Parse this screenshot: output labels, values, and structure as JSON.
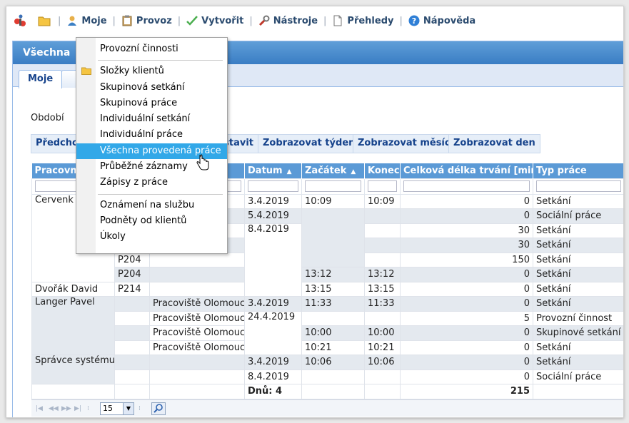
{
  "menubar": {
    "items": [
      {
        "label": "Moje",
        "icon": "user-icon"
      },
      {
        "label": "Provoz",
        "icon": "clipboard-icon"
      },
      {
        "label": "Vytvořit",
        "icon": "checkmark-icon"
      },
      {
        "label": "Nástroje",
        "icon": "wrench-icon"
      },
      {
        "label": "Přehledy",
        "icon": "document-icon"
      },
      {
        "label": "Nápověda",
        "icon": "help-icon"
      }
    ],
    "separator": "|"
  },
  "panel": {
    "title": "Všechna",
    "tabs": [
      "Moje"
    ],
    "period_label": "Období",
    "toolbar": [
      "Předcho",
      "stavit",
      "Zobrazovat týden",
      "Zobrazovat měsíc",
      "Zobrazovat den"
    ]
  },
  "dropdown": {
    "items": [
      "Provozní činnosti",
      "Složky klientů",
      "Skupinová setkání",
      "Skupinová práce",
      "Individuální setkání",
      "Individuální práce",
      "Všechna provedená práce",
      "Průběžné záznamy",
      "Zápisy z práce",
      "Oznámení na službu",
      "Podněty od klientů",
      "Úkoly"
    ],
    "active_index": 6
  },
  "grid": {
    "columns": [
      "Pracovn",
      "",
      "",
      "Datum",
      "Začátek",
      "Konec",
      "Celková délka trvání [min]",
      "Typ práce"
    ],
    "rows": [
      {
        "worker": "Červenk",
        "client": "",
        "place": "",
        "date": "3.4.2019",
        "start": "10:09",
        "end": "10:09",
        "duration": "0",
        "type": "Setkání"
      },
      {
        "worker": "",
        "client": "",
        "place": "",
        "date": "5.4.2019",
        "start": "",
        "end": "",
        "duration": "0",
        "type": "Sociální práce"
      },
      {
        "worker": "",
        "client": "",
        "place": "",
        "date": "8.4.2019",
        "start": "",
        "end": "",
        "duration": "30",
        "type": "Setkání"
      },
      {
        "worker": "",
        "client": "",
        "place": "",
        "date": "",
        "start": "",
        "end": "",
        "duration": "30",
        "type": "Setkání"
      },
      {
        "worker": "",
        "client": "P204",
        "place": "",
        "date": "",
        "start": "",
        "end": "",
        "duration": "150",
        "type": "Setkání"
      },
      {
        "worker": "",
        "client": "P204",
        "place": "",
        "date": "",
        "start": "13:12",
        "end": "13:12",
        "duration": "0",
        "type": "Setkání"
      },
      {
        "worker": "Dvořák David",
        "client": "P214",
        "place": "",
        "date": "",
        "start": "13:15",
        "end": "13:15",
        "duration": "0",
        "type": "Setkání"
      },
      {
        "worker": "Langer Pavel",
        "client": "",
        "place": "Pracoviště Olomouc",
        "date": "3.4.2019",
        "start": "11:33",
        "end": "11:33",
        "duration": "0",
        "type": "Setkání"
      },
      {
        "worker": "",
        "client": "",
        "place": "Pracoviště Olomouc",
        "date": "24.4.2019",
        "start": "",
        "end": "",
        "duration": "5",
        "type": "Provozní činnost"
      },
      {
        "worker": "",
        "client": "",
        "place": "Pracoviště Olomouc",
        "date": "",
        "start": "10:00",
        "end": "10:00",
        "duration": "0",
        "type": "Skupinové setkání"
      },
      {
        "worker": "",
        "client": "",
        "place": "Pracoviště Olomouc",
        "date": "",
        "start": "10:21",
        "end": "10:21",
        "duration": "0",
        "type": "Setkání"
      },
      {
        "worker": "Správce systému",
        "client": "",
        "place": "",
        "date": "3.4.2019",
        "start": "10:06",
        "end": "10:06",
        "duration": "0",
        "type": "Setkání"
      },
      {
        "worker": "",
        "client": "",
        "place": "",
        "date": "8.4.2019",
        "start": "",
        "end": "",
        "duration": "0",
        "type": "Sociální práce"
      }
    ],
    "total": {
      "days_label": "Dnů: 4",
      "duration": "215"
    }
  },
  "pager": {
    "page_size": "15"
  }
}
